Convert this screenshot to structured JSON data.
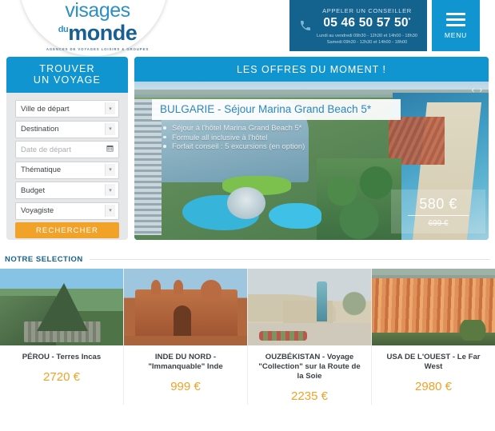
{
  "header": {
    "logo": {
      "line1": "visages",
      "du": "du",
      "line2": "monde",
      "tagline": "AGENCES DE VOYAGES LOISIRS & GROUPES"
    },
    "contact": {
      "label": "APPELER UN CONSEILLER",
      "phone": "05 46 50 57 50",
      "phone_sup": "*",
      "hours_weekday": "Lundi au vendredi 09h30 - 12h30 et 14h00 - 18h30",
      "hours_saturday": "Samedi 09h30 - 12h30 et 14h00 - 18h00"
    },
    "menu_label": "MENU"
  },
  "search": {
    "title_line1": "TROUVER",
    "title_line2": "UN VOYAGE",
    "fields": [
      {
        "label": "Ville de départ",
        "type": "select"
      },
      {
        "label": "Destination",
        "type": "select"
      },
      {
        "label": "Date de départ",
        "type": "date",
        "placeholder": true
      },
      {
        "label": "Thématique",
        "type": "select"
      },
      {
        "label": "Budget",
        "type": "select"
      },
      {
        "label": "Voyagiste",
        "type": "select"
      }
    ],
    "submit_label": "RECHERCHER"
  },
  "offers": {
    "title": "LES OFFRES DU MOMENT !",
    "prev_icon": "‹",
    "next_icon": "›",
    "slide": {
      "title": "BULGARIE - Séjour Marina Grand Beach 5*",
      "bullets": [
        "Séjour à l'hôtel Marina Grand Beach 5*",
        "Formule all inclusive à l'hôtel",
        "Forfait conseil : 5 excursions (en option)"
      ],
      "price": "580 €",
      "old_price": "699 €"
    }
  },
  "selection": {
    "title": "NOTRE SELECTION",
    "cards": [
      {
        "title": "PÉROU - Terres Incas",
        "price": "2720 €"
      },
      {
        "title": "INDE DU NORD - \"Immanquable\" Inde",
        "price": "999 €"
      },
      {
        "title": "OUZBÉKISTAN - Voyage \"Collection\" sur la Route de la Soie",
        "price": "2235 €"
      },
      {
        "title": "USA DE L'OUEST - Le Far West",
        "price": "2980 €"
      }
    ]
  },
  "colors": {
    "brand_blue": "#1195d0",
    "dark_blue": "#14628e",
    "orange": "#f0a229",
    "panel_grey": "#e6e7e8"
  }
}
